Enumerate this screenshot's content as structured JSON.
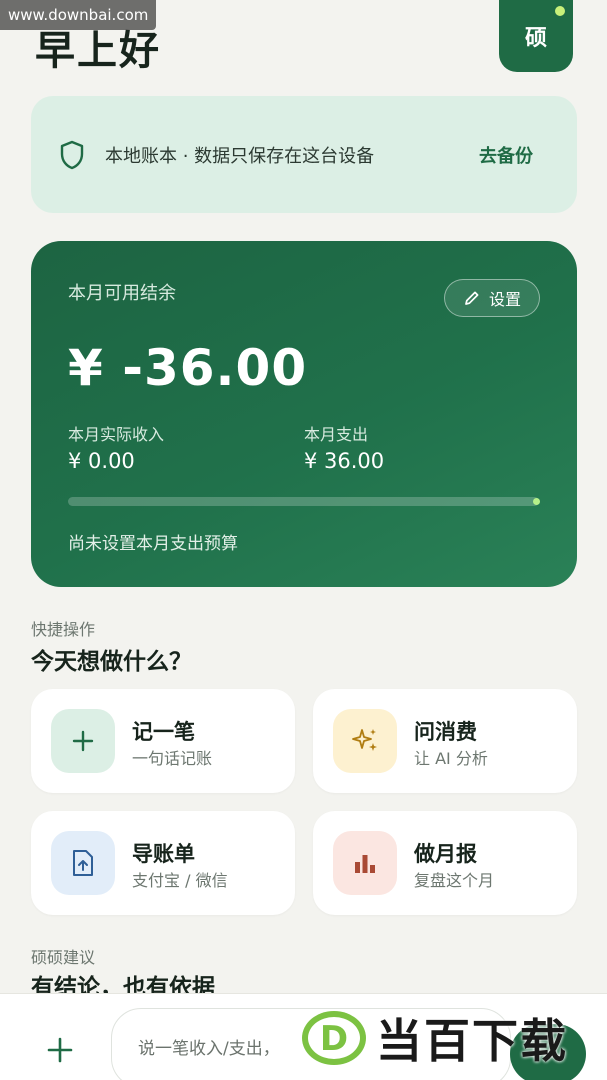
{
  "watermark": {
    "top_text": "www.downbai.com",
    "logo_letter": "D",
    "logo_text": "当百下载"
  },
  "header": {
    "greeting": "早上好",
    "avatar_text": "硕"
  },
  "notice": {
    "text": "本地账本 · 数据只保存在这台设备",
    "action": "去备份",
    "icon": "shield-icon"
  },
  "balance": {
    "label": "本月可用结余",
    "set_label": "设置",
    "amount": "¥ -36.00",
    "income_label": "本月实际收入",
    "income_value": "¥ 0.00",
    "expense_label": "本月支出",
    "expense_value": "¥ 36.00",
    "budget_hint": "尚未设置本月支出预算",
    "budget_progress": 1.0
  },
  "quick": {
    "caption": "快捷操作",
    "title": "今天想做什么？",
    "actions": [
      {
        "title": "记一笔",
        "desc": "一句话记账",
        "icon": "plus-icon",
        "bg": "#dcefe5",
        "fg": "#1f6b45"
      },
      {
        "title": "问消费",
        "desc": "让 AI 分析",
        "icon": "sparkle-icon",
        "bg": "#fdf1d0",
        "fg": "#b07d12"
      },
      {
        "title": "导账单",
        "desc": "支付宝 / 微信",
        "icon": "file-upload-icon",
        "bg": "#e2edf9",
        "fg": "#2f5f97"
      },
      {
        "title": "做月报",
        "desc": "复盘这个月",
        "icon": "bar-chart-icon",
        "bg": "#fbe6e1",
        "fg": "#a94a35"
      }
    ]
  },
  "advice": {
    "caption": "硕硕建议",
    "title": "有结论，也有依据"
  },
  "composer": {
    "placeholder": "说一笔收入/支出，"
  },
  "colors": {
    "brand": "#1f6b45",
    "background": "#f3f3ef"
  }
}
